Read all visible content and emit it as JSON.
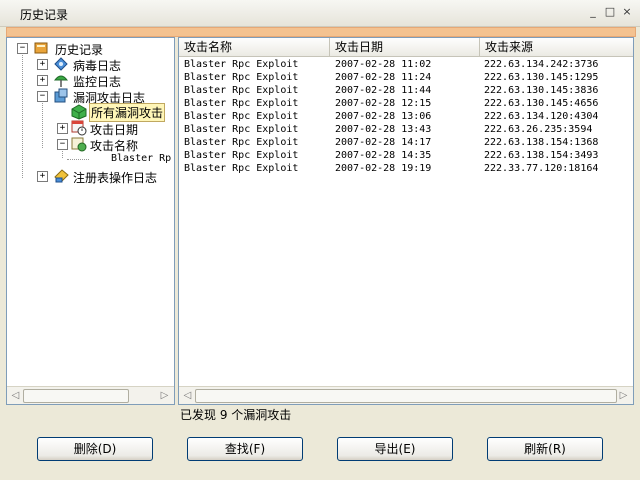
{
  "window": {
    "title": "历史记录",
    "controls": [
      "_",
      "□",
      "×"
    ]
  },
  "tree": {
    "items": [
      {
        "label": "历史记录",
        "expander": "−",
        "icon": "history-book-icon"
      },
      {
        "label": "病毒日志",
        "expander": "+",
        "icon": "virus-log-icon"
      },
      {
        "label": "监控日志",
        "expander": "+",
        "icon": "monitor-umbrella-icon"
      },
      {
        "label": "漏洞攻击日志",
        "expander": "−",
        "icon": "vulnerability-icon"
      },
      {
        "label": "所有漏洞攻击",
        "expander": "",
        "icon": "cube-icon"
      },
      {
        "label": "攻击日期",
        "expander": "+",
        "icon": "calendar-clock-icon"
      },
      {
        "label": "攻击名称",
        "expander": "−",
        "icon": "tag-icon"
      },
      {
        "label": "Blaster Rp",
        "expander": "",
        "icon": ""
      },
      {
        "label": "注册表操作日志",
        "expander": "+",
        "icon": "registry-icon"
      }
    ]
  },
  "table": {
    "columns": [
      "攻击名称",
      "攻击日期",
      "攻击来源"
    ],
    "rows": [
      [
        "Blaster Rpc Exploit",
        "2007-02-28 11:02",
        "222.63.134.242:3736"
      ],
      [
        "Blaster Rpc Exploit",
        "2007-02-28 11:24",
        "222.63.130.145:1295"
      ],
      [
        "Blaster Rpc Exploit",
        "2007-02-28 11:44",
        "222.63.130.145:3836"
      ],
      [
        "Blaster Rpc Exploit",
        "2007-02-28 12:15",
        "222.63.130.145:4656"
      ],
      [
        "Blaster Rpc Exploit",
        "2007-02-28 13:06",
        "222.63.134.120:4304"
      ],
      [
        "Blaster Rpc Exploit",
        "2007-02-28 13:43",
        "222.63.26.235:3594"
      ],
      [
        "Blaster Rpc Exploit",
        "2007-02-28 14:17",
        "222.63.138.154:1368"
      ],
      [
        "Blaster Rpc Exploit",
        "2007-02-28 14:35",
        "222.63.138.154:3493"
      ],
      [
        "Blaster Rpc Exploit",
        "2007-02-28 19:19",
        "222.33.77.120:18164"
      ]
    ]
  },
  "status": "已发现 9 个漏洞攻击",
  "buttons": {
    "delete": "删除(D)",
    "find": "查找(F)",
    "export": "导出(E)",
    "refresh": "刷新(R)"
  },
  "colors": {
    "accent_bar": "#f4c290",
    "selected": "#fff6b8",
    "border": "#7f9db9"
  }
}
